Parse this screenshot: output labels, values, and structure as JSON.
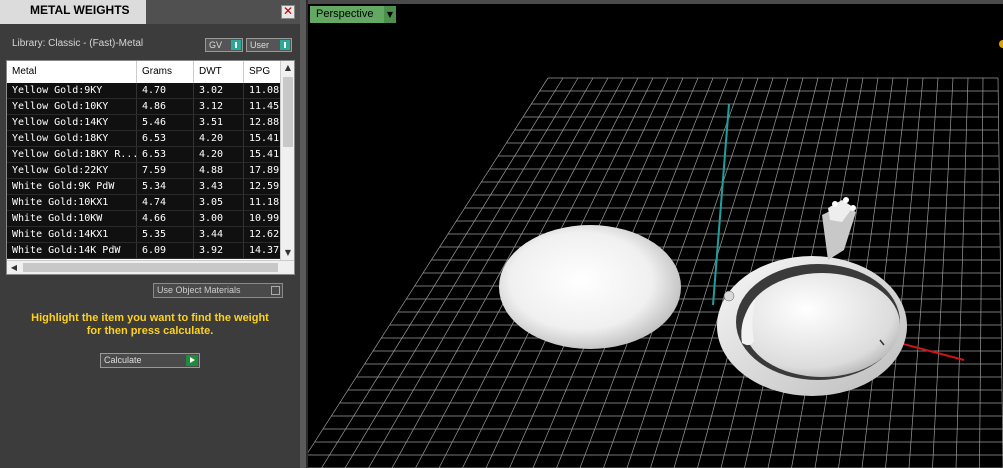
{
  "panel": {
    "title": "METAL WEIGHTS",
    "close_symbol": "✕",
    "library_label": "Library: Classic - (Fast)-Metal",
    "gv_combo": "GV",
    "user_combo": "User",
    "table": {
      "headers": [
        "Metal",
        "Grams",
        "DWT",
        "SPG"
      ],
      "rows": [
        [
          "Yellow Gold:9KY",
          "4.70",
          "3.02",
          "11.08"
        ],
        [
          "Yellow Gold:10KY",
          "4.86",
          "3.12",
          "11.45"
        ],
        [
          "Yellow Gold:14KY",
          "5.46",
          "3.51",
          "12.88"
        ],
        [
          "Yellow Gold:18KY",
          "6.53",
          "4.20",
          "15.41"
        ],
        [
          "Yellow Gold:18KY R...",
          "6.53",
          "4.20",
          "15.41"
        ],
        [
          "Yellow Gold:22KY",
          "7.59",
          "4.88",
          "17.89"
        ],
        [
          "White Gold:9K PdW",
          "5.34",
          "3.43",
          "12.59"
        ],
        [
          "White Gold:10KX1",
          "4.74",
          "3.05",
          "11.18"
        ],
        [
          "White Gold:10KW",
          "4.66",
          "3.00",
          "10.99"
        ],
        [
          "White Gold:14KX1",
          "5.35",
          "3.44",
          "12.62"
        ],
        [
          "White Gold:14K PdW",
          "6.09",
          "3.92",
          "14.37"
        ]
      ]
    },
    "use_object_materials": "Use Object Materials",
    "instruction_line1": "Highlight the item you want to find the weight",
    "instruction_line2": "for then press calculate.",
    "calculate_label": "Calculate"
  },
  "viewport": {
    "view_mode": "Perspective"
  },
  "colors": {
    "accent_yellow": "#ffd21a",
    "view_tab_green": "#63a863",
    "axis_y": "#1fa0a0",
    "axis_x": "#d01515"
  }
}
